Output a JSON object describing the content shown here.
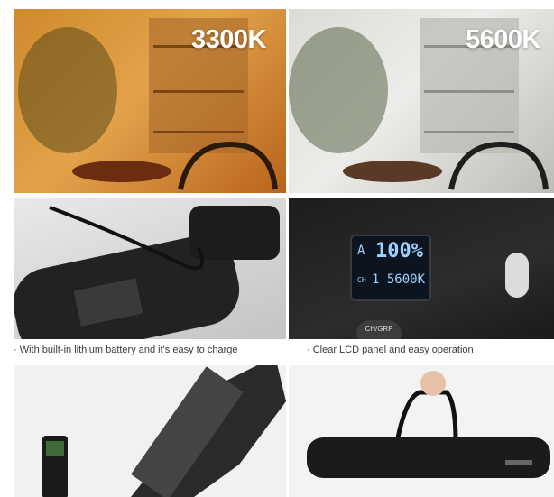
{
  "panels": {
    "warm": {
      "label": "3300K"
    },
    "cool": {
      "label": "5600K"
    },
    "lcd": {
      "mode": "A",
      "brightness": "100%",
      "channel": "CH",
      "value": "1 5600K",
      "button_label": "CH/GRP"
    }
  },
  "captions": {
    "battery": "· With built-in lithium battery and it's easy to charge",
    "lcd": "· Clear LCD panel and easy operation"
  },
  "colors": {
    "warm_tone": "#d08a2c",
    "cool_tone": "#dcdcd6",
    "lcd_text": "#9fd0ff"
  }
}
